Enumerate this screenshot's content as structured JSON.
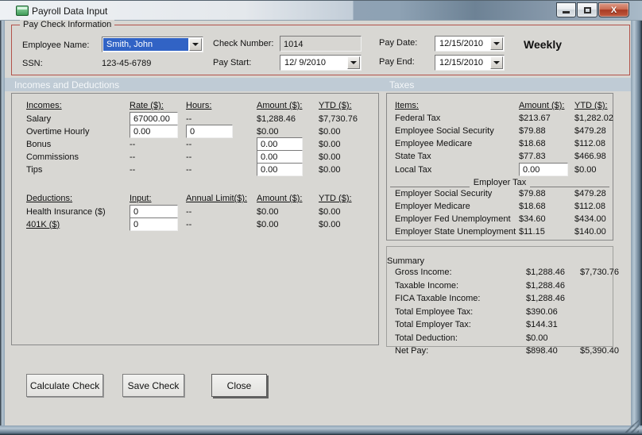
{
  "window": {
    "title": "Payroll Data Input"
  },
  "icons": {
    "close": "X"
  },
  "paycheck_info": {
    "group_title": "Pay Check Information",
    "employee_name": {
      "label": "Employee Name:",
      "value": "Smith, John"
    },
    "ssn": {
      "label": "SSN:",
      "value": "123-45-6789"
    },
    "check_number": {
      "label": "Check Number:",
      "value": "1014"
    },
    "pay_start": {
      "label": "Pay Start:",
      "value": "12/ 9/2010"
    },
    "pay_date": {
      "label": "Pay Date:",
      "value": "12/15/2010"
    },
    "pay_end": {
      "label": "Pay End:",
      "value": "12/15/2010"
    },
    "frequency": "Weekly"
  },
  "sections": {
    "left": "Incomes and Deductions",
    "right": "Taxes"
  },
  "incomes": {
    "col_headers": [
      "Incomes:",
      "Rate ($):",
      "Hours:",
      "Amount ($):",
      "YTD ($):"
    ],
    "rows": [
      {
        "name": "Salary",
        "rate": "67000.00",
        "hours": "--",
        "amount": "$1,288.46",
        "ytd": "$7,730.76"
      },
      {
        "name": "Overtime Hourly",
        "rate": "0.00",
        "hours": "0",
        "amount": "$0.00",
        "ytd": "$0.00"
      },
      {
        "name": "Bonus",
        "rate": "--",
        "hours": "--",
        "amount": "0.00",
        "ytd": "$0.00"
      },
      {
        "name": "Commissions",
        "rate": "--",
        "hours": "--",
        "amount": "0.00",
        "ytd": "$0.00"
      },
      {
        "name": "Tips",
        "rate": "--",
        "hours": "--",
        "amount": "0.00",
        "ytd": "$0.00"
      }
    ]
  },
  "deductions": {
    "col_headers": [
      "Deductions:",
      "Input:",
      "Annual Limit($):",
      "Amount ($):",
      "YTD ($):"
    ],
    "rows": [
      {
        "name": "Health Insurance  ($)",
        "input": "0",
        "annual_limit": "--",
        "amount": "$0.00",
        "ytd": "$0.00"
      },
      {
        "name": "401K  ($)",
        "input": "0",
        "annual_limit": "--",
        "amount": "$0.00",
        "ytd": "$0.00"
      }
    ]
  },
  "taxes": {
    "col_headers": [
      "Items:",
      "Amount ($):",
      "YTD ($):"
    ],
    "rows": [
      {
        "name": "Federal Tax",
        "amount": "$213.67",
        "ytd": "$1,282.02"
      },
      {
        "name": "Employee Social Security",
        "amount": "$79.88",
        "ytd": "$479.28"
      },
      {
        "name": "Employee Medicare",
        "amount": "$18.68",
        "ytd": "$112.08"
      },
      {
        "name": "State Tax",
        "amount": "$77.83",
        "ytd": "$466.98"
      }
    ],
    "local_tax": {
      "name": "Local Tax",
      "amount": "0.00",
      "ytd": "$0.00"
    },
    "employer_header": "Employer Tax",
    "employer_rows": [
      {
        "name": "Employer Social Security",
        "amount": "$79.88",
        "ytd": "$479.28"
      },
      {
        "name": "Employer Medicare",
        "amount": "$18.68",
        "ytd": "$112.08"
      },
      {
        "name": "Employer Fed Unemployment",
        "amount": "$34.60",
        "ytd": "$434.00"
      },
      {
        "name": "Employer State Unemployment",
        "amount": "$11.15",
        "ytd": "$140.00"
      }
    ]
  },
  "summary": {
    "group_title": "Summary",
    "rows": [
      {
        "label": "Gross Income:",
        "amount": "$1,288.46",
        "ytd": "$7,730.76"
      },
      {
        "label": "Taxable Income:",
        "amount": "$1,288.46",
        "ytd": ""
      },
      {
        "label": "FICA Taxable Income:",
        "amount": "$1,288.46",
        "ytd": ""
      },
      {
        "label": "Total Employee Tax:",
        "amount": "$390.06",
        "ytd": ""
      },
      {
        "label": "Total Employer Tax:",
        "amount": "$144.31",
        "ytd": ""
      },
      {
        "label": "Total Deduction:",
        "amount": "$0.00",
        "ytd": ""
      },
      {
        "label": "Net Pay:",
        "amount": "$898.40",
        "ytd": "$5,390.40"
      }
    ]
  },
  "buttons": {
    "calculate": "Calculate Check",
    "save": "Save Check",
    "close": "Close"
  },
  "colors": {
    "section_bar": "#bfcbd5",
    "group_border": "#b2524a",
    "selection": "#3163c5",
    "close_button": "#b3462f"
  }
}
